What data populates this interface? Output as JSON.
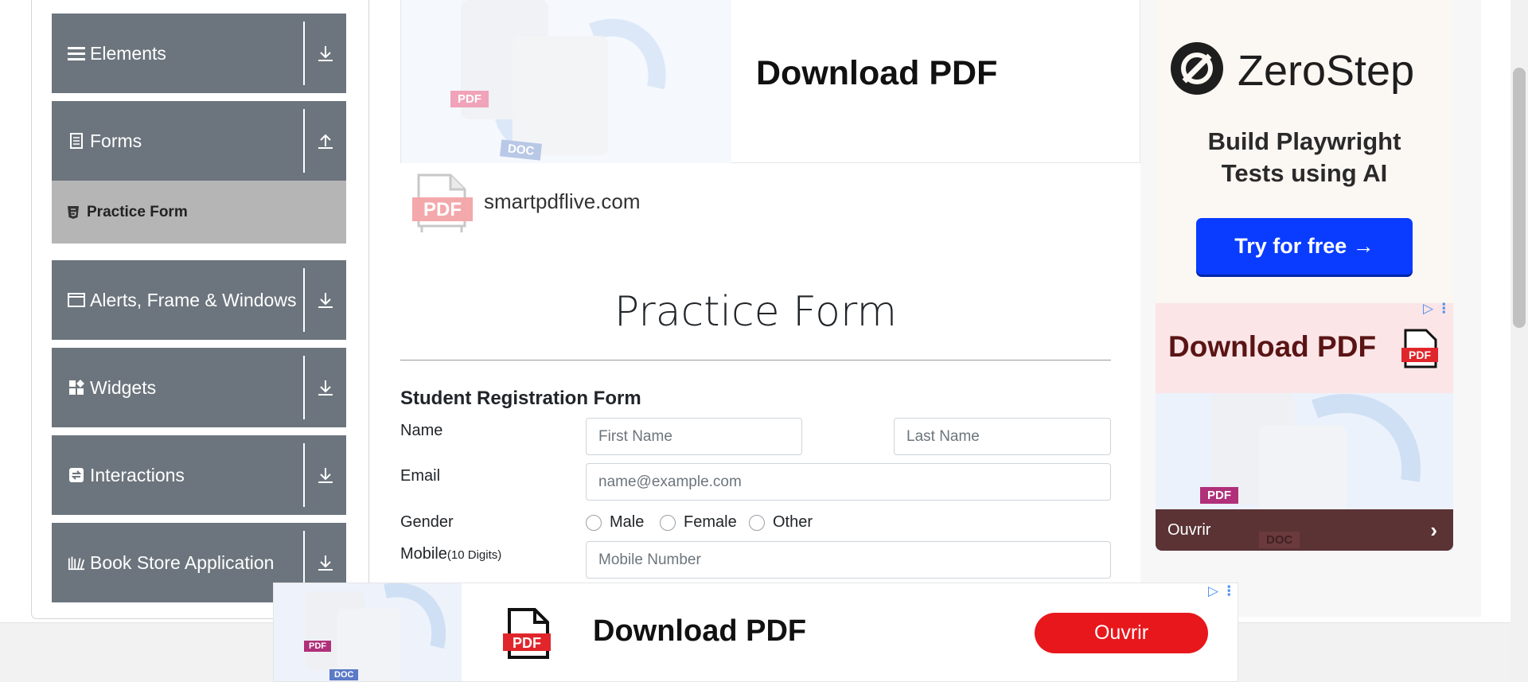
{
  "sidebar": {
    "groups": [
      {
        "label": "Elements",
        "icon": "hamburger-icon",
        "arrow": "download-arrow-icon"
      },
      {
        "label": "Forms",
        "icon": "document-icon",
        "arrow": "upload-arrow-icon"
      },
      {
        "label": "Alerts, Frame & Windows",
        "icon": "window-icon",
        "arrow": "download-arrow-icon"
      },
      {
        "label": "Widgets",
        "icon": "widgets-icon",
        "arrow": "download-arrow-icon"
      },
      {
        "label": "Interactions",
        "icon": "interactions-icon",
        "arrow": "download-arrow-icon"
      },
      {
        "label": "Book Store Application",
        "icon": "books-icon",
        "arrow": "download-arrow-icon"
      }
    ],
    "active_item": "Practice Form"
  },
  "banner": {
    "title": "Download PDF",
    "badge_pdf": "PDF",
    "badge_doc": "DOC",
    "site": "smartpdflive.com",
    "site_icon_text": "PDF"
  },
  "form": {
    "title": "Practice Form",
    "subtitle": "Student Registration Form",
    "name_label": "Name",
    "first_name_placeholder": "First Name",
    "last_name_placeholder": "Last Name",
    "email_label": "Email",
    "email_placeholder": "name@example.com",
    "gender_label": "Gender",
    "gender_options": [
      "Male",
      "Female",
      "Other"
    ],
    "mobile_label": "Mobile",
    "mobile_hint": "(10 Digits)",
    "mobile_placeholder": "Mobile Number"
  },
  "right_ad": {
    "brand": "ZeroStep",
    "tagline_line1": "Build Playwright",
    "tagline_line2": "Tests using AI",
    "cta": "Try for free →",
    "ad2_title": "Download PDF",
    "ad2_icon_text": "PDF",
    "ad2_badge_pdf": "PDF",
    "ad2_badge_doc": "DOC",
    "ad2_button": "Ouvrir",
    "ad2_chevron": "›"
  },
  "bottom_ad": {
    "title": "Download PDF",
    "button": "Ouvrir",
    "icon_text": "PDF",
    "badge_pdf": "PDF",
    "badge_doc": "DOC"
  },
  "colors": {
    "sidebar_group": "#6c757d",
    "sidebar_active": "#b5b5b5",
    "zerostep_button": "#0a3cff",
    "ouvrir_button": "#e8171c",
    "pdf_red": "#e0262b"
  }
}
